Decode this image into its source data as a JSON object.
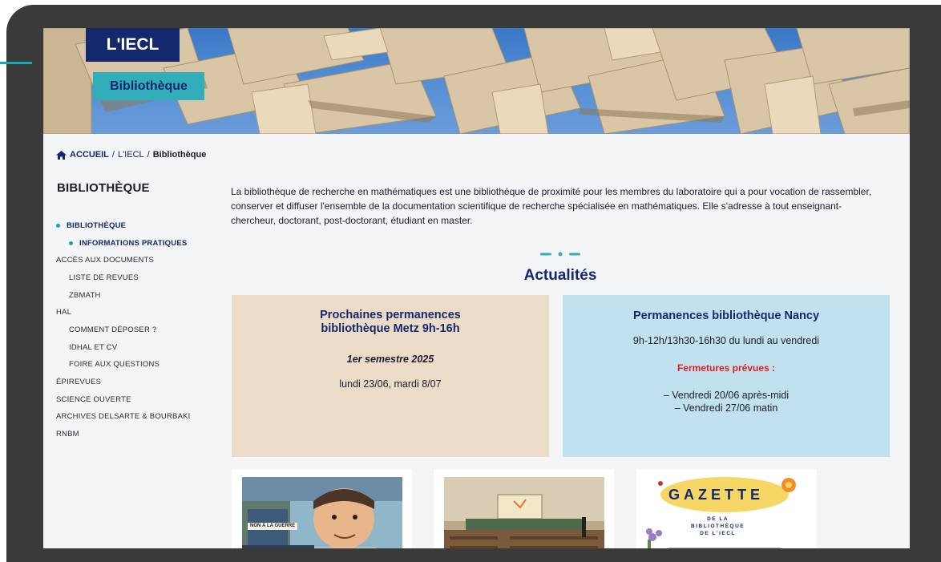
{
  "hero": {
    "tag_iecl": "L'IECL",
    "tag_section": "Bibliothèque"
  },
  "breadcrumb": {
    "home": "ACCUEIL",
    "sep": "/",
    "parent": "L'IECL",
    "current": "Bibliothèque"
  },
  "sidebar": {
    "title": "BIBLIOTHÈQUE",
    "items": [
      {
        "label": "BIBLIOTHÈQUE",
        "level": 1,
        "active": true
      },
      {
        "label": "INFORMATIONS PRATIQUES",
        "level": 2,
        "active": true
      },
      {
        "label": "ACCÈS AUX DOCUMENTS",
        "level": 1,
        "active": false
      },
      {
        "label": "LISTE DE REVUES",
        "level": 2,
        "active": false
      },
      {
        "label": "ZBMATH",
        "level": 2,
        "active": false
      },
      {
        "label": "HAL",
        "level": 1,
        "active": false
      },
      {
        "label": "COMMENT DÉPOSER ?",
        "level": 2,
        "active": false
      },
      {
        "label": "IDHAL ET CV",
        "level": 2,
        "active": false
      },
      {
        "label": "FOIRE AUX QUESTIONS",
        "level": 2,
        "active": false
      },
      {
        "label": "ÉPIREVUES",
        "level": 1,
        "active": false
      },
      {
        "label": "SCIENCE OUVERTE",
        "level": 1,
        "active": false
      },
      {
        "label": "ARCHIVES DELSARTE & BOURBAKI",
        "level": 1,
        "active": false
      },
      {
        "label": "RNBM",
        "level": 1,
        "active": false
      }
    ]
  },
  "main": {
    "intro": "La bibliothèque de recherche en mathématiques est une bibliothèque de proximité pour les membres du laboratoire qui a pour vocation de rassembler, conserver et diffuser l'ensemble de la documentation scientifique de recherche spécialisée en mathématiques. Elle s'adresse à tout enseignant-chercheur, doctorant, post-doctorant, étudiant en master.",
    "news_title": "Actualités",
    "card_metz": {
      "title": "Prochaines permanences bibliothèque Metz 9h-16h",
      "subtitle": "1er semestre 2025",
      "text": "lundi 23/06, mardi 8/07"
    },
    "card_nancy": {
      "title": "Permanences bibliothèque Nancy",
      "hours": "9h-12h/13h30-16h30 du lundi au vendredi",
      "closures_title": "Fermetures prévues :",
      "closure_1": "– Vendredi 20/06 après-midi",
      "closure_2": "– Vendredi 27/06 matin"
    },
    "thumbs": {
      "comic_sign": "NON À LA GUERRE",
      "gazette_title": "GAZETTE",
      "gazette_sub_1": "DE LA",
      "gazette_sub_2": "BIBLIOTHÈQUE",
      "gazette_sub_3": "DE L'IECL"
    }
  },
  "colors": {
    "navy": "#14286e",
    "teal": "#32aebb",
    "card_metz_bg": "#ecdcc7",
    "card_nancy_bg": "#c2e1ee",
    "alert_red": "#e01c1c"
  }
}
